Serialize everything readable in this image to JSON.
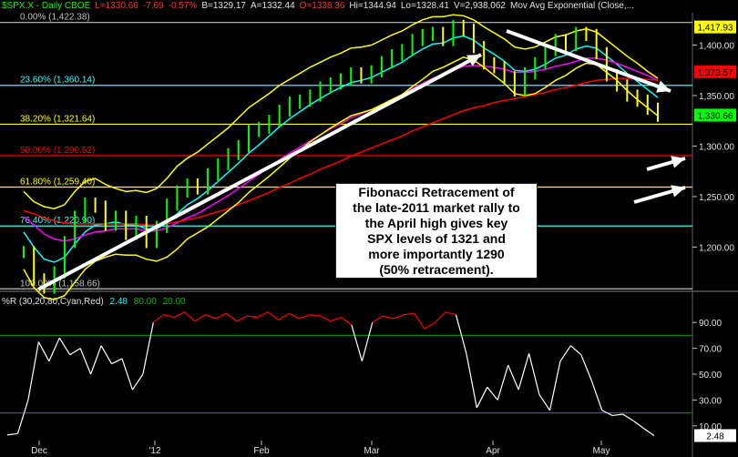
{
  "header": {
    "symbol": "$SPX.X - Daily  CBOE",
    "last": "L=1330.66",
    "change": "-7.69",
    "pct": "-0.57%",
    "bid": "B=1329.17",
    "ask": "A=1332.44",
    "open": "O=1338.36",
    "high": "Hi=1344.94",
    "low": "Lo=1328.41",
    "volume": "V=2,938,062",
    "indicator": "Mov Avg Exponential (Close,..."
  },
  "annotation": {
    "lines": [
      "Fibonacci Retracement of",
      "the late-2011 market rally to",
      "the April high gives key",
      "SPX levels of 1321 and",
      "more importantly 1290",
      "(50% retracement)."
    ]
  },
  "wr_header": {
    "label": "%R (30,20,80,Cyan,Red)",
    "value": "2.48",
    "upper": "80.00",
    "lower": "20.00"
  },
  "colors": {
    "price_bars": "#00ff00",
    "ema_fast": "#00ffff",
    "ema_mid": "#ff00ff",
    "ema_slow": "#ff0000",
    "band": "#ffff00",
    "fib_cyan": "#33ffff",
    "fib_yellow": "#ffff00",
    "fib_red": "#ff0000",
    "wr_line": "#ffffff",
    "wr_overbought": "#ff0000",
    "wr_band": "#00a000"
  },
  "chart_data": [
    {
      "type": "line",
      "panel": "price",
      "ylim": [
        1158,
        1432
      ],
      "yticks": [
        "1,400.00",
        "1,350.00",
        "1,300.00",
        "1,250.00",
        "1,200.00"
      ],
      "ytick_values": [
        1400,
        1350,
        1300,
        1250,
        1200
      ],
      "xticks": [
        "Dec",
        "'12",
        "Feb",
        "Mar",
        "Apr",
        "May"
      ],
      "fib_levels": [
        {
          "label": "0.00% (1,422.38)",
          "value": 1422.38,
          "color": "#c0c0c0"
        },
        {
          "label": "23.60% (1,360.14)",
          "value": 1360.14,
          "color": "#33ffff"
        },
        {
          "label": "38.20% (1,321.64)",
          "value": 1321.64,
          "color": "#ffff00"
        },
        {
          "label": "50.00% (1,290.52)",
          "value": 1290.52,
          "color": "#ff0000"
        },
        {
          "label": "61.80% (1,259.40)",
          "value": 1259.4,
          "color": "#ffff00"
        },
        {
          "label": "76.40% (1,220.90)",
          "value": 1220.9,
          "color": "#33ffff"
        },
        {
          "label": "100.00% (1,158.66)",
          "value": 1158.66,
          "color": "#c0c0c0"
        }
      ],
      "right_tags": [
        {
          "text": "1,417.93",
          "value": 1417.93,
          "bg": "#ffff00",
          "fg": "#000000"
        },
        {
          "text": "1,373.57",
          "value": 1373.57,
          "bg": "#ff0000",
          "fg": "#000000"
        },
        {
          "text": "1,330.66",
          "value": 1330.66,
          "bg": "#00ff00",
          "fg": "#000000"
        }
      ],
      "series": [
        {
          "role": "close",
          "values": [
            1195,
            1168,
            1160,
            1175,
            1205,
            1230,
            1243,
            1240,
            1222,
            1230,
            1213,
            1225,
            1205,
            1220,
            1242,
            1255,
            1262,
            1258,
            1272,
            1282,
            1292,
            1300,
            1315,
            1318,
            1325,
            1335,
            1343,
            1345,
            1350,
            1358,
            1362,
            1366,
            1372,
            1368,
            1374,
            1383,
            1390,
            1395,
            1405,
            1410,
            1412,
            1405,
            1419,
            1415,
            1398,
            1382,
            1378,
            1368,
            1355,
            1372,
            1382,
            1395,
            1405,
            1400,
            1412,
            1410,
            1392,
            1370,
            1360,
            1350,
            1345,
            1337,
            1330
          ]
        },
        {
          "role": "ema_fast",
          "values": [
            1215,
            1200,
            1188,
            1185,
            1190,
            1203,
            1215,
            1222,
            1223,
            1225,
            1222,
            1222,
            1218,
            1218,
            1224,
            1233,
            1242,
            1248,
            1256,
            1265,
            1274,
            1283,
            1293,
            1301,
            1310,
            1319,
            1327,
            1334,
            1341,
            1347,
            1353,
            1358,
            1363,
            1365,
            1368,
            1373,
            1378,
            1383,
            1390,
            1396,
            1401,
            1402,
            1407,
            1409,
            1405,
            1397,
            1391,
            1384,
            1375,
            1374,
            1376,
            1381,
            1387,
            1390,
            1396,
            1399,
            1397,
            1389,
            1381,
            1372,
            1364,
            1356,
            1348
          ]
        },
        {
          "role": "ema_mid",
          "values": [
            1230,
            1222,
            1213,
            1208,
            1206,
            1208,
            1212,
            1215,
            1216,
            1218,
            1218,
            1218,
            1216,
            1216,
            1219,
            1224,
            1229,
            1233,
            1239,
            1245,
            1251,
            1258,
            1265,
            1272,
            1279,
            1286,
            1293,
            1299,
            1305,
            1311,
            1317,
            1322,
            1328,
            1332,
            1336,
            1341,
            1346,
            1351,
            1357,
            1362,
            1367,
            1370,
            1375,
            1379,
            1380,
            1379,
            1378,
            1376,
            1373,
            1373,
            1374,
            1376,
            1379,
            1381,
            1384,
            1387,
            1387,
            1385,
            1382,
            1378,
            1374,
            1370,
            1365
          ]
        },
        {
          "role": "ema_slow",
          "values": [
            1236,
            1233,
            1229,
            1226,
            1224,
            1223,
            1223,
            1223,
            1223,
            1223,
            1223,
            1223,
            1222,
            1222,
            1223,
            1225,
            1227,
            1229,
            1232,
            1235,
            1238,
            1242,
            1246,
            1250,
            1254,
            1259,
            1263,
            1268,
            1272,
            1277,
            1281,
            1285,
            1290,
            1294,
            1298,
            1302,
            1306,
            1310,
            1315,
            1319,
            1323,
            1327,
            1331,
            1335,
            1338,
            1340,
            1343,
            1345,
            1347,
            1349,
            1351,
            1353,
            1356,
            1358,
            1360,
            1363,
            1365,
            1366,
            1367,
            1367,
            1367,
            1366,
            1365
          ]
        },
        {
          "role": "band_upper",
          "values": [
            1255,
            1245,
            1240,
            1238,
            1242,
            1255,
            1265,
            1268,
            1262,
            1258,
            1255,
            1256,
            1254,
            1258,
            1268,
            1280,
            1288,
            1294,
            1302,
            1310,
            1318,
            1328,
            1338,
            1345,
            1352,
            1360,
            1366,
            1372,
            1378,
            1383,
            1388,
            1392,
            1397,
            1398,
            1400,
            1405,
            1410,
            1414,
            1420,
            1425,
            1428,
            1428,
            1430,
            1429,
            1425,
            1418,
            1412,
            1406,
            1398,
            1396,
            1398,
            1403,
            1408,
            1410,
            1414,
            1416,
            1413,
            1405,
            1397,
            1389,
            1382,
            1374,
            1367
          ]
        },
        {
          "role": "band_lower",
          "values": [
            1178,
            1160,
            1150,
            1148,
            1152,
            1165,
            1178,
            1186,
            1190,
            1193,
            1192,
            1192,
            1188,
            1186,
            1190,
            1198,
            1208,
            1214,
            1220,
            1228,
            1236,
            1244,
            1254,
            1262,
            1270,
            1279,
            1288,
            1296,
            1304,
            1311,
            1318,
            1324,
            1330,
            1333,
            1336,
            1341,
            1346,
            1351,
            1359,
            1366,
            1374,
            1378,
            1383,
            1388,
            1385,
            1378,
            1370,
            1362,
            1352,
            1350,
            1352,
            1358,
            1365,
            1370,
            1377,
            1382,
            1381,
            1373,
            1365,
            1355,
            1346,
            1338,
            1330
          ]
        }
      ]
    },
    {
      "type": "line",
      "panel": "williams_r",
      "ylim": [
        0,
        100
      ],
      "yticks": [
        "90.00",
        "70.00",
        "50.00",
        "30.00",
        "10.00"
      ],
      "ytick_values": [
        90,
        70,
        50,
        30,
        10
      ],
      "bands": [
        80,
        20
      ],
      "x": [
        0,
        1,
        2,
        3,
        4,
        5,
        6,
        7,
        8,
        9,
        10,
        11,
        12,
        13,
        14,
        15,
        16,
        17,
        18,
        19,
        20,
        21,
        22,
        23,
        24,
        25,
        26,
        27,
        28,
        29,
        30,
        31,
        32,
        33,
        34,
        35,
        36,
        37,
        38,
        39,
        40,
        41,
        42,
        43,
        44,
        45,
        46,
        47,
        48,
        49,
        50,
        51,
        52,
        53,
        54,
        55,
        56,
        57,
        58,
        59,
        60,
        61,
        62
      ],
      "values": [
        3,
        4,
        30,
        75,
        60,
        78,
        65,
        70,
        50,
        72,
        58,
        62,
        38,
        50,
        90,
        96,
        94,
        98,
        91,
        96,
        93,
        97,
        91,
        95,
        94,
        98,
        92,
        97,
        93,
        96,
        95,
        91,
        94,
        88,
        60,
        90,
        95,
        93,
        96,
        97,
        85,
        90,
        98,
        96,
        66,
        24,
        40,
        30,
        57,
        38,
        66,
        34,
        22,
        60,
        72,
        65,
        45,
        22,
        18,
        19,
        14,
        8,
        2.48
      ],
      "title": "%R (30,20,80,Cyan,Red)"
    }
  ]
}
